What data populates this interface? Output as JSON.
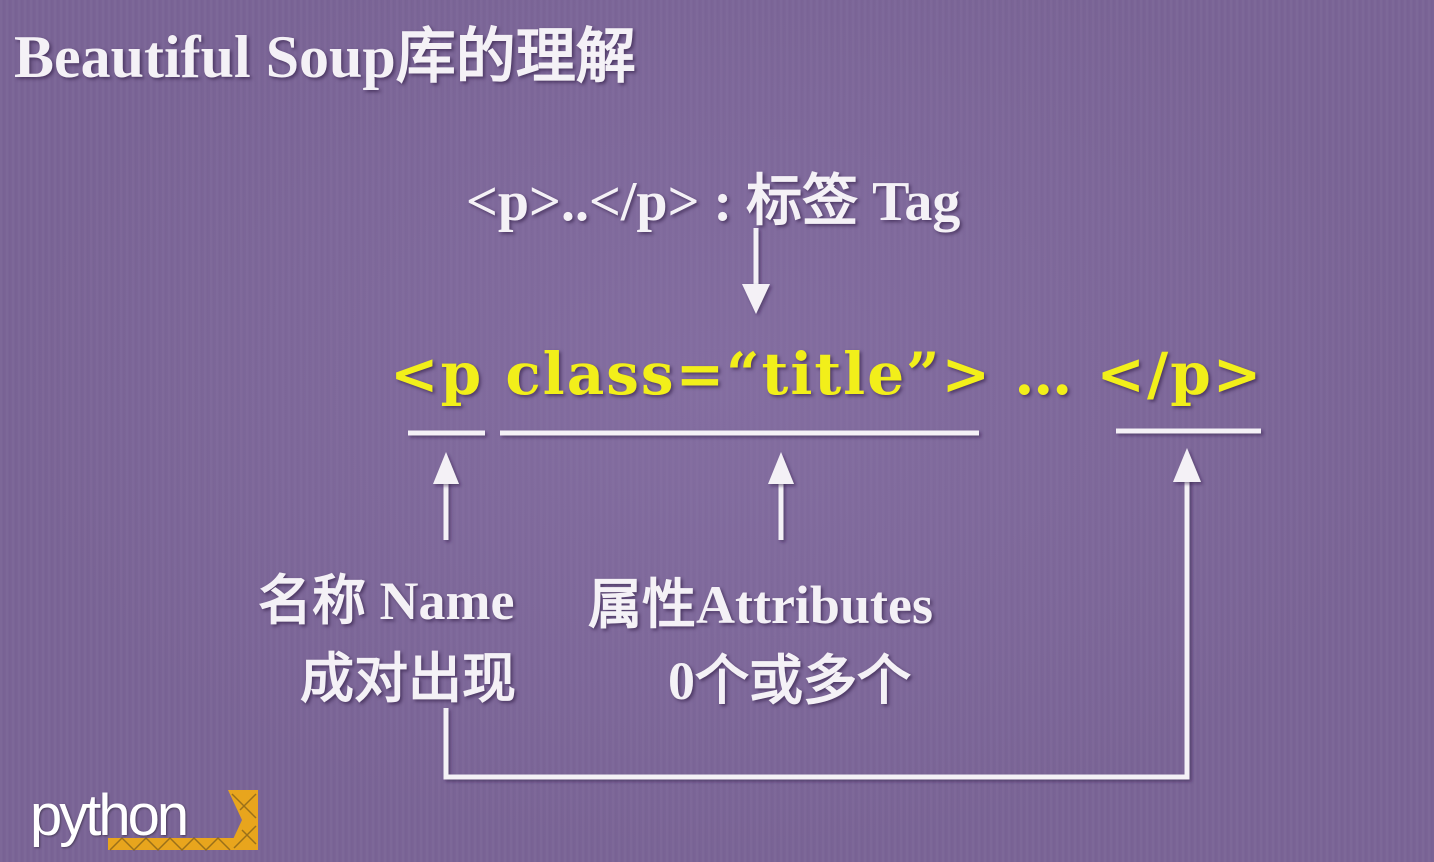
{
  "title": "Beautiful Soup库的理解",
  "tag_label": "<p>..</p> : 标签 Tag",
  "tag_code": "<p class=“title”> … </p>",
  "name_label": "名称 Name",
  "pair_label": "成对出现",
  "attr_label": "属性Attributes",
  "count_label": "0个或多个",
  "logo_text": "python",
  "colors": {
    "background": "#7a6496",
    "text": "#f4f1f6",
    "code": "#f2ef1a",
    "lines": "#f4f1f6",
    "logo_accent": "#e8a51d"
  }
}
